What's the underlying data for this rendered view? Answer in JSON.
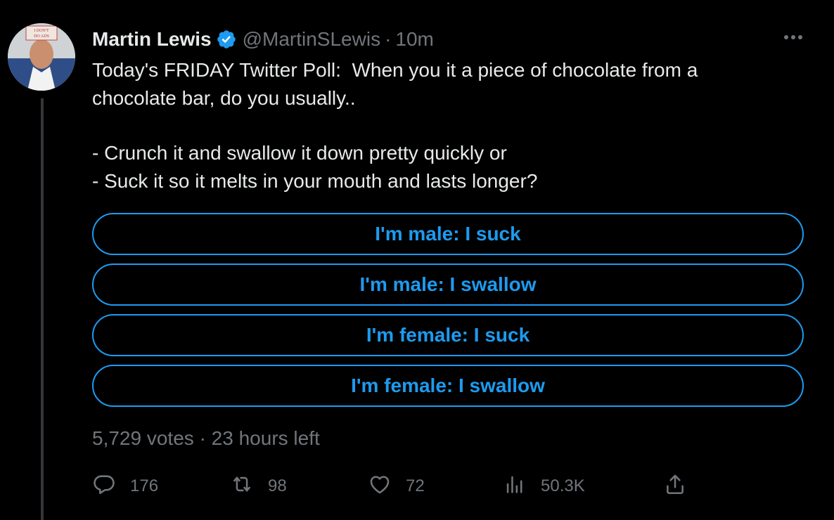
{
  "author": {
    "name": "Martin Lewis",
    "handle": "@MartinSLewis",
    "separator": "·",
    "time": "10m",
    "avatar_sign_text": "I DON'T DO ADS"
  },
  "tweet": {
    "lines": [
      "Today's FRIDAY Twitter Poll:  When you it a piece of chocolate from a",
      "chocolate bar, do you usually..",
      "- Crunch it and swallow it down pretty quickly or",
      "- Suck it so it melts in your mouth and lasts longer?"
    ]
  },
  "poll": {
    "options": [
      "I'm male: I suck",
      "I'm male: I swallow",
      "I'm female: I suck",
      "I'm female: I swallow"
    ],
    "votes": "5,729 votes",
    "separator": "·",
    "time_left": "23 hours left"
  },
  "actions": {
    "replies": "176",
    "retweets": "98",
    "likes": "72",
    "views": "50.3K"
  },
  "colors": {
    "background": "#000000",
    "text": "#e7e9ea",
    "muted": "#71767b",
    "accent": "#1d9bf0"
  },
  "icons": [
    "verified-badge-icon",
    "more-icon",
    "reply-icon",
    "retweet-icon",
    "like-icon",
    "views-icon",
    "share-icon"
  ]
}
